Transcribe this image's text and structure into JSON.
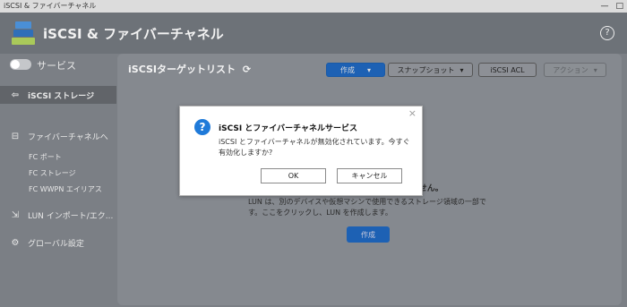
{
  "window": {
    "title": "iSCSI & ファイバーチャネル",
    "controls": [
      "—",
      "□"
    ]
  },
  "header": {
    "title": "iSCSI & ファイバーチャネル",
    "help_icon": "?"
  },
  "sidebar": {
    "service_label": "サービス",
    "items": [
      {
        "label": "iSCSI ストレージ",
        "icon": "arrow-left-icon"
      },
      {
        "label": "ファイバーチャネルへ",
        "icon": "fc-icon"
      },
      {
        "label": "LUN インポート/エク...",
        "icon": "import-icon"
      },
      {
        "label": "グローバル設定",
        "icon": "gear-icon"
      }
    ],
    "sub_items": [
      "FC ポート",
      "FC ストレージ",
      "FC WWPN エイリアス"
    ]
  },
  "panel": {
    "title": "iSCSIターゲットリスト",
    "toolbar": {
      "create": "作成",
      "snapshot": "スナップショット",
      "iscsi_acl": "iSCSI ACL",
      "action": "アクション"
    },
    "empty_title_tail": "ません。",
    "empty_msg": "LUN は、別のデバイスや仮想マシンで使用できるストレージ領域の一部です。ここをクリックし、LUN を作成します。",
    "create_button": "作成"
  },
  "dialog": {
    "close": "×",
    "icon": "?",
    "title": "iSCSI とファイバーチャネルサービス",
    "message": "iSCSI とファイバーチャネルが無効化されています。今すぐ有効化しますか?",
    "ok": "OK",
    "cancel": "キャンセル"
  },
  "colors": {
    "accent": "#1d61b4",
    "question_icon": "#1f7ad9"
  }
}
